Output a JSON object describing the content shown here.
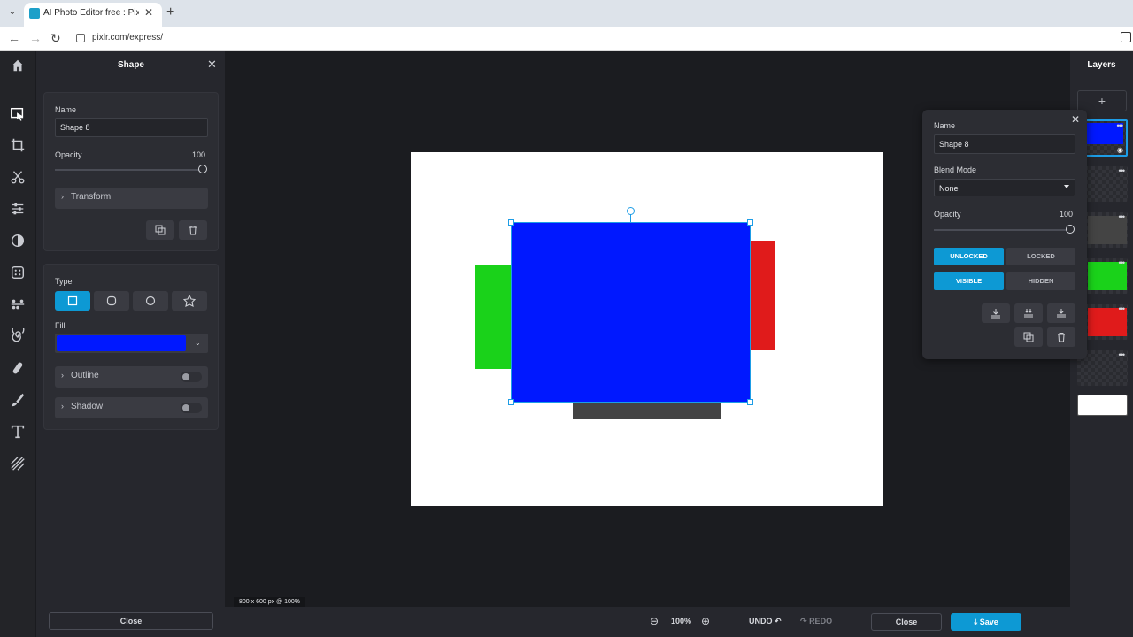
{
  "browser": {
    "tab_title": "AI Photo Editor free : Pixlr Expre",
    "url": "pixlr.com/express/"
  },
  "left_panel": {
    "title": "Shape",
    "name_label": "Name",
    "name_value": "Shape 8",
    "opacity_label": "Opacity",
    "opacity_value": "100",
    "transform_label": "Transform",
    "type_label": "Type",
    "fill_label": "Fill",
    "fill_color": "#0018ff",
    "outline_label": "Outline",
    "shadow_label": "Shadow",
    "close_label": "Close"
  },
  "canvas": {
    "size_label": "800 x 600 px @ 100%"
  },
  "bottom_bar": {
    "zoom": "100%",
    "undo": "UNDO",
    "redo": "REDO",
    "close": "Close",
    "save": "Save"
  },
  "layers": {
    "title": "Layers",
    "add": "+",
    "items": [
      {
        "color": "#0018ff",
        "selected": true
      },
      {
        "color": "",
        "selected": false
      },
      {
        "color": "#444444",
        "selected": false
      },
      {
        "color": "#1ad21a",
        "selected": false
      },
      {
        "color": "#e01b1b",
        "selected": false
      },
      {
        "color": "",
        "selected": false
      },
      {
        "color": "#ffffff",
        "selected": false
      }
    ]
  },
  "layer_popup": {
    "name_label": "Name",
    "name_value": "Shape 8",
    "blend_label": "Blend Mode",
    "blend_value": "None",
    "opacity_label": "Opacity",
    "opacity_value": "100",
    "unlocked": "UNLOCKED",
    "locked": "LOCKED",
    "visible": "VISIBLE",
    "hidden": "HIDDEN"
  },
  "colors": {
    "accent": "#0d99d4",
    "shape_blue": "#0018ff",
    "shape_green": "#1ad21a",
    "shape_red": "#e01b1b",
    "shape_gray": "#444444"
  }
}
